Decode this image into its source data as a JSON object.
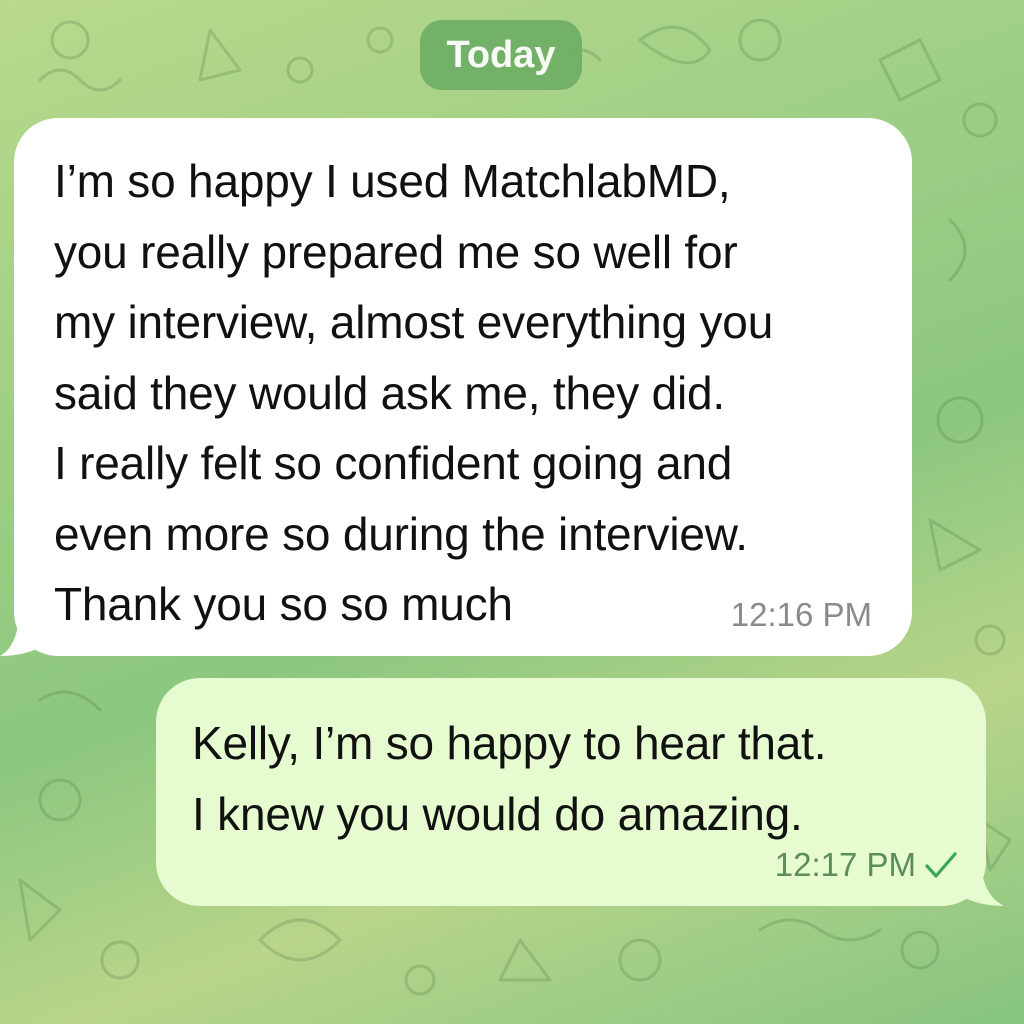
{
  "chat": {
    "date_separator": "Today",
    "messages": [
      {
        "direction": "incoming",
        "text": "I’m so happy I used MatchlabMD,\nyou really prepared me so well for\nmy interview, almost everything you\nsaid they would ask me, they did.\nI really felt so confident going and\neven more so during the interview.\nThank you so so much",
        "time": "12:16 PM"
      },
      {
        "direction": "outgoing",
        "text": "Kelly, I’m so happy to hear that.\nI knew you would do amazing.",
        "time": "12:17 PM",
        "status_icon": "single-check-icon"
      }
    ]
  },
  "colors": {
    "incoming_bubble": "#ffffff",
    "outgoing_bubble": "#e6fbd0",
    "date_pill": "#6fae66",
    "check": "#3aa757"
  }
}
